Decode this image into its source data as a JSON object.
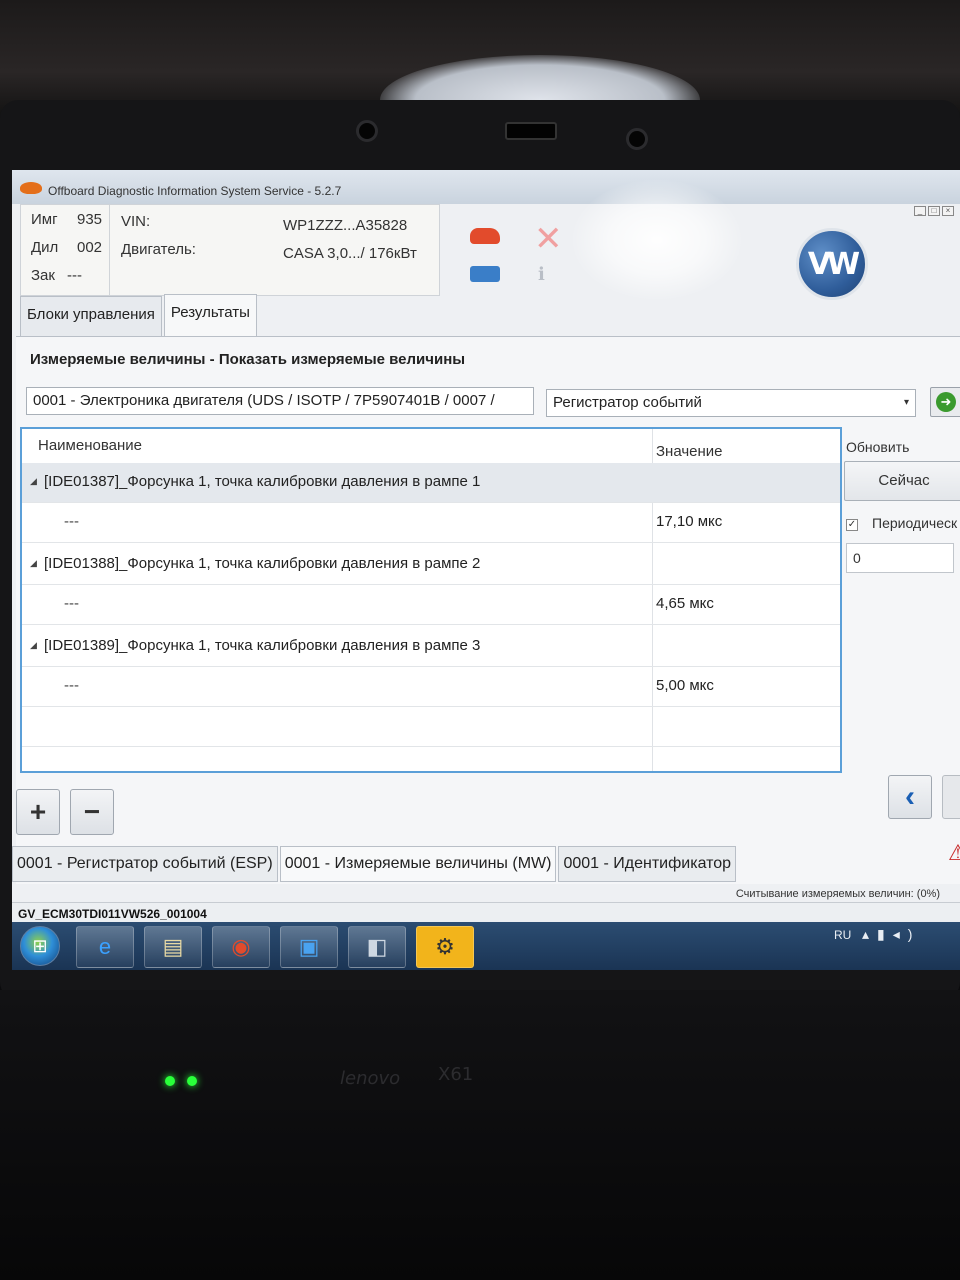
{
  "window": {
    "title": "Offboard Diagnostic Information System Service - 5.2.7"
  },
  "vehicle_info": {
    "img_label": "Имг",
    "img_value": "935",
    "dil_label": "Дил",
    "dil_value": "002",
    "zak_label": "Зак",
    "zak_value": "---",
    "vin_label": "VIN:",
    "vin_value": "WP1ZZZ...A35828",
    "engine_label": "Двигатель:",
    "engine_value": "CASA 3,0.../ 176кВт"
  },
  "brand": {
    "logo_text": "VW"
  },
  "tabs_top": [
    {
      "label": "Блоки управления"
    },
    {
      "label": "Результаты"
    }
  ],
  "section_title": "Измеряемые величины - Показать измеряемые величины",
  "ecu_select": {
    "value": "0001 - Электроника двигателя  (UDS / ISOTP / 7P5907401B / 0007 /"
  },
  "mode_select": {
    "value": "Регистратор событий"
  },
  "table": {
    "headers": {
      "name": "Наименование",
      "value": "Значение"
    },
    "groups": [
      {
        "name": "[IDE01387]_Форсунка 1, точка калибровки давления в рампе 1",
        "sub_name": "---",
        "value": "17,10 мкс"
      },
      {
        "name": "[IDE01388]_Форсунка 1, точка калибровки давления в рампе 2",
        "sub_name": "---",
        "value": "4,65 мкс"
      },
      {
        "name": "[IDE01389]_Форсунка 1, точка калибровки давления в рампе 3",
        "sub_name": "---",
        "value": "5,00 мкс"
      }
    ]
  },
  "refresh": {
    "label": "Обновить",
    "now_button": "Сейчас",
    "periodic_label": "Периодическ",
    "periodic_checked": true,
    "interval_value": "0"
  },
  "bottom_tabs": [
    {
      "label": "0001 - Регистратор событий (ESP)"
    },
    {
      "label": "0001 - Измеряемые величины (MW)"
    },
    {
      "label": "0001 - Идентификатор"
    }
  ],
  "progress_text": "Считывание измеряемых величин: (0%)",
  "status_left": "GV_ECM30TDI011VW526_001004",
  "taskbar": {
    "lang": "RU"
  },
  "hardware": {
    "brand": "lenovo",
    "model": "X61"
  }
}
